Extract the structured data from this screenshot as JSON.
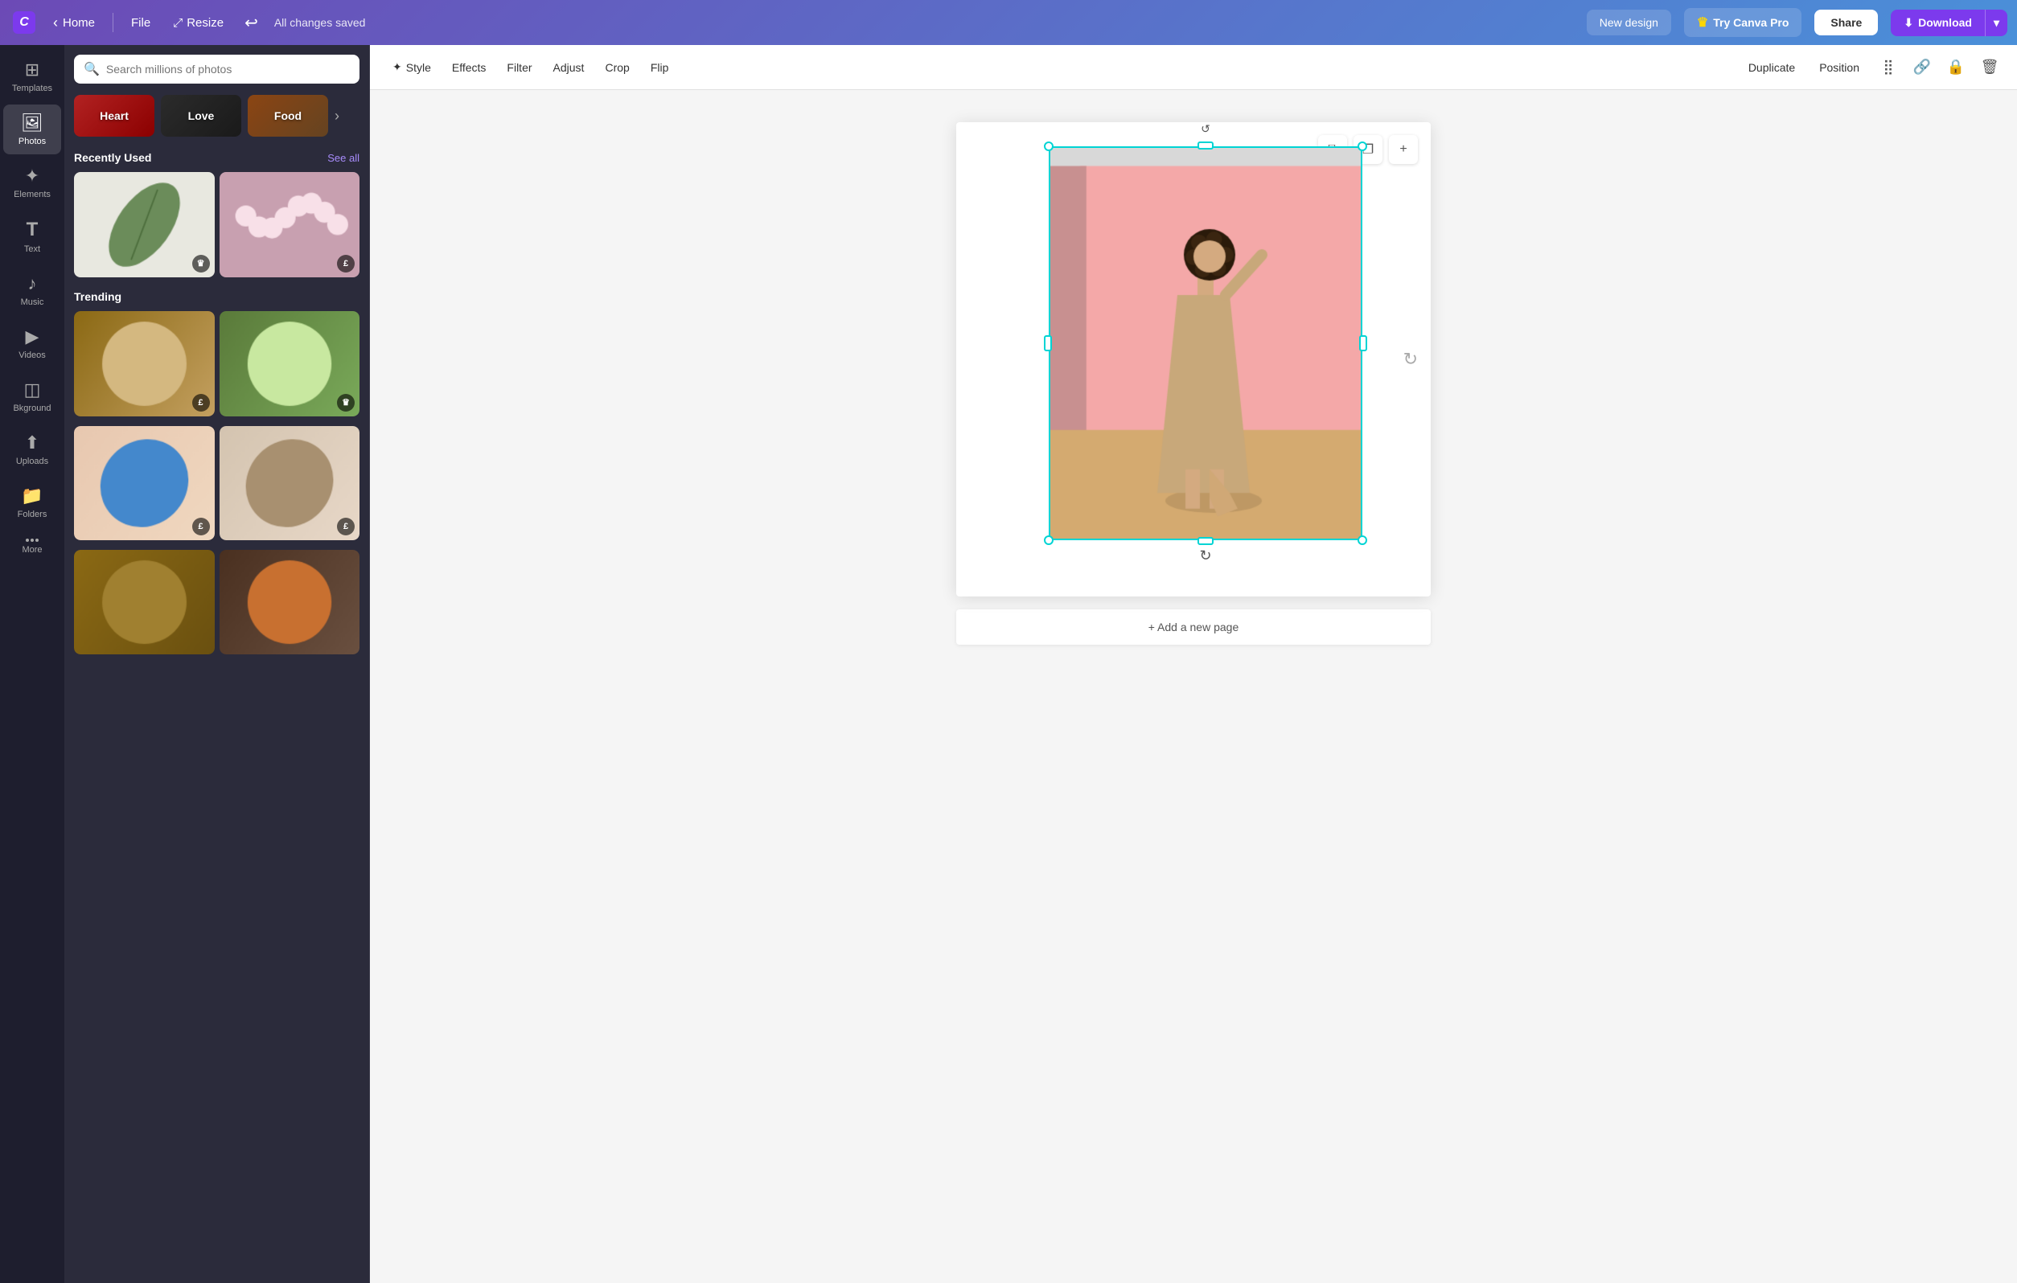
{
  "topNav": {
    "home_label": "Home",
    "file_label": "File",
    "resize_label": "Resize",
    "saved_label": "All changes saved",
    "new_design_label": "New design",
    "try_pro_label": "Try Canva Pro",
    "share_label": "Share",
    "download_label": "Download"
  },
  "sidebar": {
    "items": [
      {
        "id": "templates",
        "label": "Templates",
        "icon": "⊞"
      },
      {
        "id": "photos",
        "label": "Photos",
        "icon": "🖼"
      },
      {
        "id": "elements",
        "label": "Elements",
        "icon": "✦"
      },
      {
        "id": "text",
        "label": "Text",
        "icon": "T"
      },
      {
        "id": "music",
        "label": "Music",
        "icon": "♪"
      },
      {
        "id": "videos",
        "label": "Videos",
        "icon": "▶"
      },
      {
        "id": "background",
        "label": "Bkground",
        "icon": "◫"
      },
      {
        "id": "uploads",
        "label": "Uploads",
        "icon": "↑"
      },
      {
        "id": "folders",
        "label": "Folders",
        "icon": "📁"
      },
      {
        "id": "more",
        "label": "More",
        "icon": "···"
      }
    ]
  },
  "photosPanel": {
    "search_placeholder": "Search millions of photos",
    "categories": [
      {
        "id": "heart",
        "label": "Heart"
      },
      {
        "id": "love",
        "label": "Love"
      },
      {
        "id": "food",
        "label": "Food"
      }
    ],
    "recently_used_title": "Recently Used",
    "see_all_label": "See all",
    "trending_title": "Trending"
  },
  "toolbar": {
    "style_label": "Style",
    "effects_label": "Effects",
    "filter_label": "Filter",
    "adjust_label": "Adjust",
    "crop_label": "Crop",
    "flip_label": "Flip",
    "duplicate_label": "Duplicate",
    "position_label": "Position"
  },
  "canvas": {
    "add_page_label": "+ Add a new page",
    "rotate_icon": "↻"
  }
}
